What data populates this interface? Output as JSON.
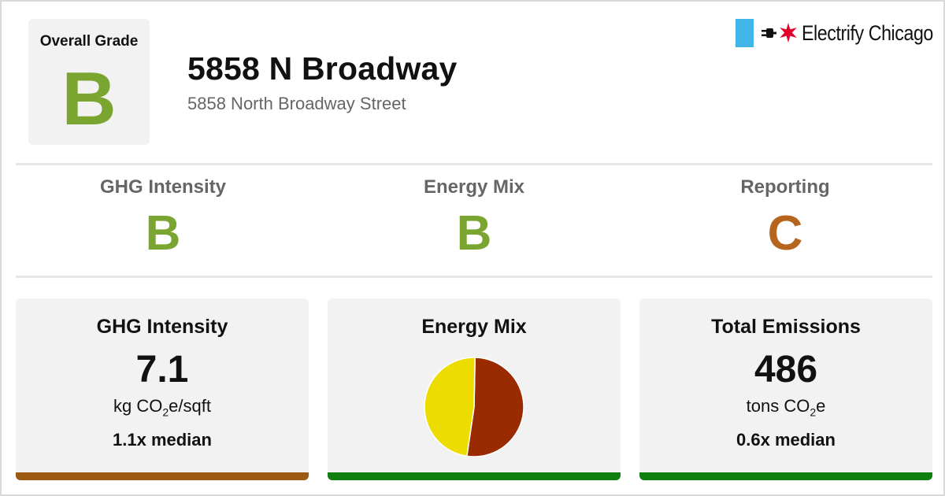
{
  "overall": {
    "label": "Overall Grade",
    "grade": "B",
    "grade_color": "#7aa531"
  },
  "building": {
    "name": "5858 N Broadway",
    "address": "5858 North Broadway Street"
  },
  "brand": {
    "name": "Electrify Chicago",
    "flag_color": "#41b6e6",
    "star_color": "#e4002b",
    "flag_icon": "chicago-flag-icon",
    "plug_icon": "plug-icon",
    "star_icon": "star-icon"
  },
  "grades": [
    {
      "label": "GHG Intensity",
      "grade": "B",
      "color": "#7aa531"
    },
    {
      "label": "Energy Mix",
      "grade": "B",
      "color": "#7aa531"
    },
    {
      "label": "Reporting",
      "grade": "C",
      "color": "#b5651d"
    }
  ],
  "panels": {
    "ghg": {
      "title": "GHG Intensity",
      "value": "7.1",
      "unit_main": "kg CO",
      "unit_sub": "2",
      "unit_tail": "e/sqft",
      "median": "1.1x median",
      "bar_color": "#9c5a12"
    },
    "mix": {
      "title": "Energy Mix",
      "bar_color": "#0f7f10"
    },
    "total": {
      "title": "Total Emissions",
      "value": "486",
      "unit_main": "tons CO",
      "unit_sub": "2",
      "unit_tail": "e",
      "median": "0.6x median",
      "bar_color": "#0f7f10"
    }
  },
  "chart_data": {
    "type": "pie",
    "title": "",
    "slices": [
      {
        "share": 0.52,
        "color": "#9a2b00"
      },
      {
        "share": 0.48,
        "color": "#eddc00"
      }
    ]
  }
}
